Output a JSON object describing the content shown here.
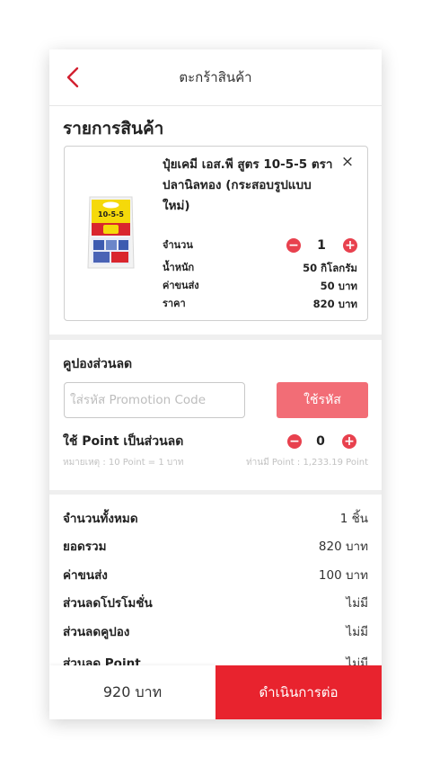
{
  "header": {
    "title": "ตะกร้าสินค้า",
    "back_icon": "chevron-left-icon"
  },
  "cart": {
    "section_title": "รายการสินค้า",
    "item": {
      "title_lines": [
        "ปุ๋ยเคมี เอส.พี สูตร 10-5-5 ตรา",
        "ปลานิลทอง (กระสอบรูปแบบ",
        "ใหม่)"
      ],
      "remove_icon": "close-icon",
      "image_label": "10-5-5",
      "quantity_label": "จำนวน",
      "quantity": "1",
      "weight_label": "น้ำหนัก",
      "weight": "50 กิโลกรัม",
      "shipping_label": "ค่าขนส่ง",
      "shipping": "50 บาท",
      "price_label": "ราคา",
      "price": "820 บาท"
    }
  },
  "coupon": {
    "section_title": "คูปองส่วนลด",
    "placeholder": "ใส่รหัส Promotion Code",
    "value": "",
    "apply_label": "ใช้รหัส"
  },
  "points": {
    "section_title": "ใช้ Point เป็นส่วนลด",
    "value": "0",
    "note": "หมายเหตุ : 10 Point = 1 บาท",
    "balance": "ท่านมี Point : 1,233.19 Point"
  },
  "summary": {
    "rows": [
      {
        "label": "จำนวนทั้งหมด",
        "value": "1 ชิ้น"
      },
      {
        "label": "ยอดรวม",
        "value": "820 บาท"
      },
      {
        "label": "ค่าขนส่ง",
        "value": "100 บาท"
      },
      {
        "label": "ส่วนลดโปรโมชั่น",
        "value": "ไม่มี"
      },
      {
        "label": "ส่วนลดคูปอง",
        "value": "ไม่มี"
      },
      {
        "label": "ส่วนลด Point",
        "value": "ไม่มี"
      }
    ]
  },
  "footer": {
    "total": "920 บาท",
    "checkout_label": "ดำเนินการต่อ"
  },
  "colors": {
    "accent": "#e8232e",
    "stepper": "#e8414e",
    "apply_button": "#f26d76",
    "back_icon": "#d32030"
  }
}
